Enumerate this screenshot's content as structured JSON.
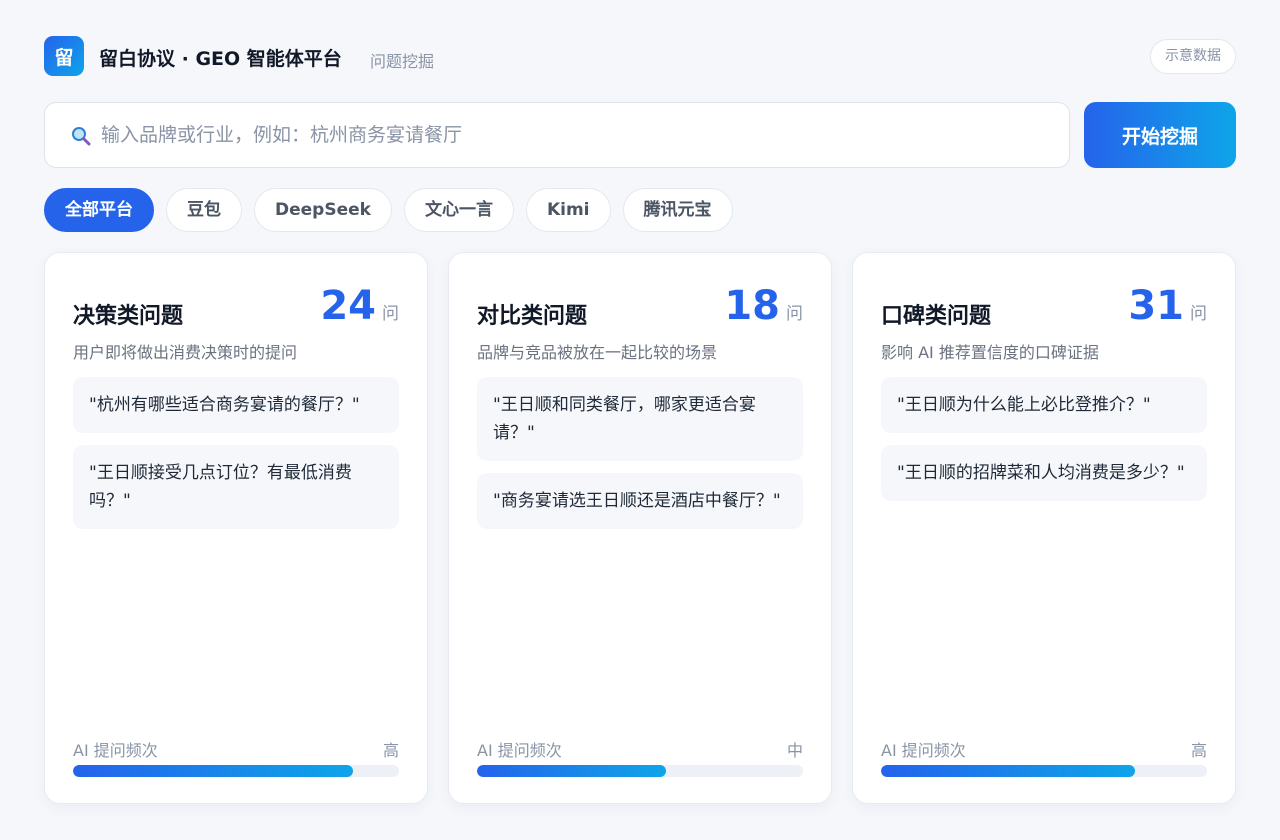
{
  "header": {
    "logo_char": "留",
    "title": "留白协议 · GEO 智能体平台",
    "subtitle": "问题挖掘",
    "demo_badge": "示意数据"
  },
  "search": {
    "icon": "search-icon",
    "value": "",
    "placeholder": "输入品牌或行业，例如：杭州商务宴请餐厅",
    "button_label": "开始挖掘"
  },
  "tabs": [
    {
      "label": "全部平台",
      "active": true
    },
    {
      "label": "豆包",
      "active": false
    },
    {
      "label": "DeepSeek",
      "active": false
    },
    {
      "label": "文心一言",
      "active": false
    },
    {
      "label": "Kimi",
      "active": false
    },
    {
      "label": "腾讯元宝",
      "active": false
    }
  ],
  "cards": [
    {
      "title": "决策类问题",
      "count": "24",
      "unit": "问",
      "desc": "用户即将做出消费决策时的提问",
      "questions": [
        "\"杭州有哪些适合商务宴请的餐厅？\"",
        "\"王日顺接受几点订位？有最低消费吗？\""
      ],
      "freq_label": "AI 提问频次",
      "freq_level": "高",
      "freq_fraction": 0.86
    },
    {
      "title": "对比类问题",
      "count": "18",
      "unit": "问",
      "desc": "品牌与竞品被放在一起比较的场景",
      "questions": [
        "\"王日顺和同类餐厅，哪家更适合宴请？\"",
        "\"商务宴请选王日顺还是酒店中餐厅？\""
      ],
      "freq_label": "AI 提问频次",
      "freq_level": "中",
      "freq_fraction": 0.58
    },
    {
      "title": "口碑类问题",
      "count": "31",
      "unit": "问",
      "desc": "影响 AI 推荐置信度的口碑证据",
      "questions": [
        "\"王日顺为什么能上必比登推介？\"",
        "\"王日顺的招牌菜和人均消费是多少？\""
      ],
      "freq_label": "AI 提问频次",
      "freq_level": "高",
      "freq_fraction": 0.78
    }
  ],
  "colors": {
    "accent": "#2563eb",
    "accent_end": "#0ea5e9",
    "background": "#f5f7fb"
  }
}
